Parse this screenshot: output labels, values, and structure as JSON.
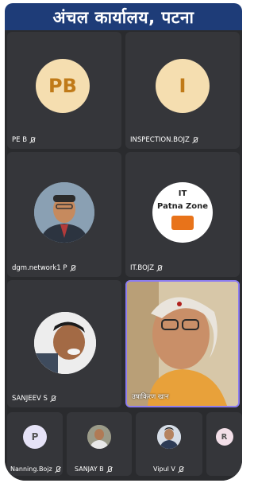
{
  "banner": {
    "title": "अंचल कार्यालय, पटना"
  },
  "tiles": [
    {
      "name": "PE B",
      "initials": "PB"
    },
    {
      "name": "INSPECTION.BOJZ",
      "initials": "I"
    },
    {
      "name": "dgm.network1 P"
    },
    {
      "name": "IT.BOJZ",
      "logo": {
        "line1": "IT",
        "line2": "Patna Zone"
      }
    },
    {
      "name": "SANJEEV S"
    },
    {
      "name": "उषाकिरण खान"
    }
  ],
  "strip": [
    {
      "name": "Nanning.Bojz",
      "initials": "P"
    },
    {
      "name": "SANJAY B"
    },
    {
      "name": "Vipul V"
    },
    {
      "name": "",
      "initials": "R"
    }
  ],
  "colors": {
    "banner": "#1e3c78",
    "active_border": "#8c7cf0",
    "avatar_bg": "#f5deb0",
    "avatar_text": "#c07a18"
  }
}
